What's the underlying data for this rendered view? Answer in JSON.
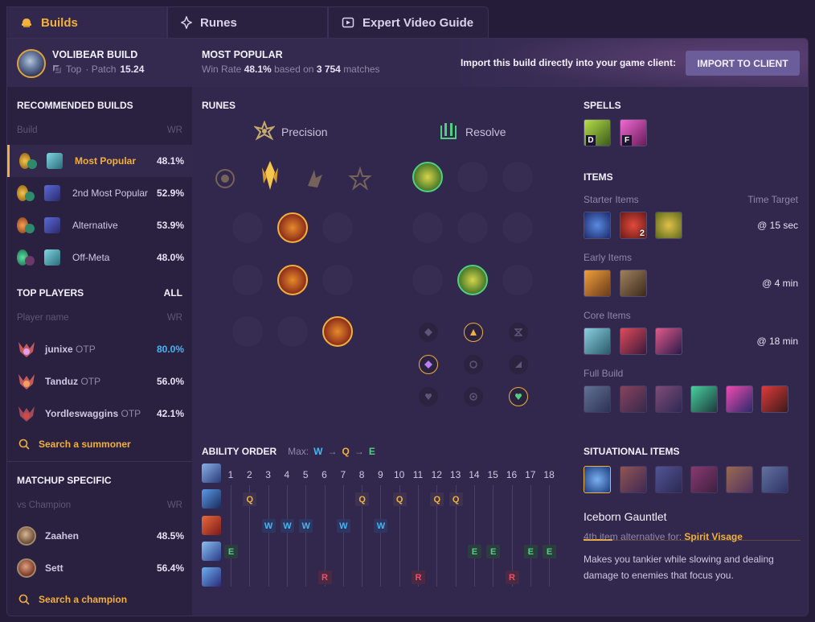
{
  "tabs": [
    {
      "label": "Builds",
      "icon": "helmet-icon"
    },
    {
      "label": "Runes",
      "icon": "runes-icon"
    },
    {
      "label": "Expert Video Guide",
      "icon": "video-icon"
    }
  ],
  "header": {
    "build_title": "VOLIBEAR BUILD",
    "role": "Top",
    "patch_prefix": "· Patch",
    "patch": "15.24",
    "popular_title": "MOST POPULAR",
    "win_rate_prefix": "Win Rate",
    "win_rate": "48.1%",
    "based_on": "based on",
    "matches_count": "3 754",
    "matches_suffix": "matches",
    "import_text": "Import this build directly into your game client:",
    "import_button": "IMPORT TO CLIENT"
  },
  "recommended": {
    "title": "RECOMMENDED BUILDS",
    "col_build": "Build",
    "col_wr": "WR",
    "rows": [
      {
        "label": "Most Popular",
        "wr": "48.1%"
      },
      {
        "label": "2nd Most Popular",
        "wr": "52.9%"
      },
      {
        "label": "Alternative",
        "wr": "53.9%"
      },
      {
        "label": "Off-Meta",
        "wr": "48.0%"
      }
    ]
  },
  "top_players": {
    "title": "TOP PLAYERS",
    "all_link": "ALL",
    "col_name": "Player name",
    "col_wr": "WR",
    "rows": [
      {
        "name": "junixe",
        "tag": "OTP",
        "wr": "80.0%"
      },
      {
        "name": "Tanduz",
        "tag": "OTP",
        "wr": "56.0%"
      },
      {
        "name": "Yordleswaggins",
        "tag": "OTP",
        "wr": "42.1%"
      }
    ],
    "search": "Search a summoner"
  },
  "matchup": {
    "title": "MATCHUP SPECIFIC",
    "col_vs": "vs Champion",
    "col_wr": "WR",
    "rows": [
      {
        "name": "Zaahen",
        "wr": "48.5%"
      },
      {
        "name": "Sett",
        "wr": "56.4%"
      }
    ],
    "search": "Search a champion"
  },
  "runes": {
    "title": "RUNES",
    "primary": "Precision",
    "secondary": "Resolve"
  },
  "ability_order": {
    "title": "ABILITY ORDER",
    "max_label": "Max:",
    "max_order": [
      "W",
      "Q",
      "E"
    ],
    "levels": [
      "1",
      "2",
      "3",
      "4",
      "5",
      "6",
      "7",
      "8",
      "9",
      "10",
      "11",
      "12",
      "13",
      "14",
      "15",
      "16",
      "17",
      "18"
    ],
    "sequence": [
      "E",
      "Q",
      "W",
      "W",
      "W",
      "R",
      "W",
      "Q",
      "W",
      "Q",
      "R",
      "Q",
      "Q",
      "E",
      "E",
      "R",
      "E",
      "E"
    ]
  },
  "spells": {
    "title": "SPELLS",
    "keys": [
      "D",
      "F"
    ]
  },
  "items": {
    "title": "ITEMS",
    "starter_label": "Starter Items",
    "time_target_label": "Time Target",
    "starter_time": "@ 15 sec",
    "potion_count": "2",
    "early_label": "Early Items",
    "early_time": "@ 4 min",
    "core_label": "Core Items",
    "core_time": "@ 18 min",
    "full_label": "Full Build"
  },
  "situational": {
    "title": "SITUATIONAL ITEMS",
    "selected_name": "Iceborn Gauntlet",
    "alt_prefix": "4th item alternative for:",
    "alt_item": "Spirit Visage",
    "description": "Makes you tankier while slowing and dealing damage to enemies that focus you."
  },
  "colors": {
    "accent": "#f2b03c",
    "q": "#f2b03c",
    "w": "#49b5f2",
    "e": "#4fd07f",
    "r": "#ef4d6a",
    "highlight_wr": "#49b5f2"
  }
}
